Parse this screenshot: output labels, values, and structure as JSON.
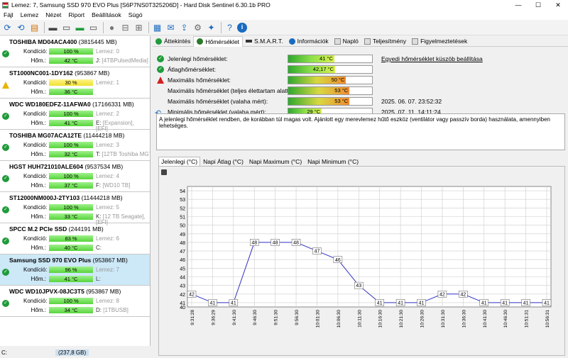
{
  "window": {
    "title": "Lemez: 7, Samsung SSD 970 EVO Plus [S6P7NS0T325206D]  -  Hard Disk Sentinel 6.30.1b PRO",
    "min": "—",
    "max": "☐",
    "close": "✕"
  },
  "menu": [
    "Fájl",
    "Lemez",
    "Nézet",
    "Riport",
    "Beállítások",
    "Súgó"
  ],
  "labels": {
    "kondicio": "Kondíció:",
    "hom": "Hőm.:"
  },
  "disks": [
    {
      "name": "TOSHIBA MD04ACA400",
      "size": "(3815445 MB)",
      "status": "ok",
      "health": "100 %",
      "healthFill": 1.0,
      "temp": "42 °C",
      "lemez": "Lemez: 0",
      "info1": "J:",
      "info1b": "[4TBPulsedMedia]",
      "info2": "",
      "info2b": ""
    },
    {
      "name": "ST1000NC001-1DY162",
      "size": "(953867 MB)",
      "status": "warn",
      "health": "30 %",
      "healthFill": 1.0,
      "temp": "36 °C",
      "lemez": "Lemez: 1",
      "info1": "",
      "info1b": "",
      "info2": "",
      "info2b": ""
    },
    {
      "name": "WDC WD180EDFZ-11AFWA0",
      "size": "(17166331 MB)",
      "status": "ok",
      "health": "100 %",
      "healthFill": 1.0,
      "temp": "41 °C",
      "lemez": "Lemez: 2",
      "info1": "E:",
      "info1b": "[Expansion],",
      "info2": "",
      "info2b": "[EFI]"
    },
    {
      "name": "TOSHIBA MG07ACA12TE",
      "size": "(11444218 MB)",
      "status": "ok",
      "health": "100 %",
      "healthFill": 1.0,
      "temp": "32 °C",
      "lemez": "Lemez: 3",
      "info1": "T:",
      "info1b": "[12TB Toshiba MG7",
      "info2": "",
      "info2b": ""
    },
    {
      "name": "HGST HUH721010ALE604",
      "size": "(9537534 MB)",
      "status": "ok",
      "health": "100 %",
      "healthFill": 1.0,
      "temp": "37 °C",
      "lemez": "Lemez: 4",
      "info1": "F:",
      "info1b": "[WD10 TB]",
      "info2": "",
      "info2b": ""
    },
    {
      "name": "ST12000NM000J-2TY103",
      "size": "(11444218 MB)",
      "status": "ok",
      "health": "100 %",
      "healthFill": 1.0,
      "temp": "33 °C",
      "lemez": "Lemez: 5",
      "info1": "K:",
      "info1b": "[12 TB Seagate],",
      "info2": "",
      "info2b": "[EFI]"
    },
    {
      "name": "SPCC M.2 PCIe SSD",
      "size": "(244191 MB)",
      "status": "ok",
      "health": "83 %",
      "healthFill": 0.83,
      "temp": "40 °C",
      "lemez": "Lemez: 6",
      "info1": "C:",
      "info1b": "",
      "info2": "",
      "info2b": ""
    },
    {
      "name": "Samsung SSD 970 EVO Plus",
      "size": "(953867 MB)",
      "status": "ok",
      "health": "96 %",
      "healthFill": 0.96,
      "temp": "41 °C",
      "lemez": "Lemez: 7",
      "info1": "L:",
      "info1b": "",
      "info2": "",
      "info2b": ""
    },
    {
      "name": "WDC WD10JPVX-08JC3T5",
      "size": "(953867 MB)",
      "status": "ok",
      "health": "100 %",
      "healthFill": 1.0,
      "temp": "34 °C",
      "lemez": "Lemez: 8",
      "info1": "D:",
      "info1b": "[1TBUSB]",
      "info2": "",
      "info2b": ""
    }
  ],
  "leftstatus": {
    "drive": "C:",
    "value": "(237,8 GB)"
  },
  "tabs": [
    "Áttekintés",
    "Hőmérséklet",
    "S.M.A.R.T.",
    "Információk",
    "Napló",
    "Teljesítmény",
    "Figyelmeztetések"
  ],
  "temps": [
    {
      "label": "Jelenlegi hőmérséklet:",
      "value": "41 °C",
      "fill": 0.55,
      "color": "g",
      "icon": "ok",
      "extra": "Egyedi hőmérséklet küszöb beállítása",
      "link": true
    },
    {
      "label": "Átlaghőmérséklet:",
      "value": "42,17 °C",
      "fill": 0.56,
      "color": "g",
      "icon": "ok",
      "extra": "",
      "link": false
    },
    {
      "label": "Maximális hőmérséklet:",
      "value": "50 °C",
      "fill": 0.69,
      "color": "o",
      "icon": "warn",
      "extra": "",
      "link": false
    },
    {
      "label": "Maximális hőmérséklet (teljes élettartam alatt):",
      "value": "53 °C",
      "fill": 0.73,
      "color": "o",
      "icon": "none",
      "extra": "",
      "link": false
    },
    {
      "label": "Maximális hőmérséklet (valaha mért):",
      "value": "53 °C",
      "fill": 0.73,
      "color": "o",
      "icon": "none",
      "extra": "2025. 06. 07. 23:52:32",
      "link": false
    },
    {
      "label": "Minimális hőmérséklet (valaha mért):",
      "value": "29 °C",
      "fill": 0.4,
      "color": "g",
      "icon": "none",
      "extra": "2025. 07. 11. 14:11:24",
      "link": false
    }
  ],
  "message": "A jelenlegi hőmérséklet rendben, de korábban túl magas volt. Ajánlott egy merevlemez hűtő eszköz (ventilátor vagy passzív borda) használata, amennyiben lehetséges.",
  "chartTabs": [
    "Jelenlegi (°C)",
    "Napi Átlag (°C)",
    "Napi Maximum (°C)",
    "Napi Minimum (°C)"
  ],
  "chart_data": {
    "type": "line",
    "x": [
      "9:31:28",
      "9:36:29",
      "9:41:30",
      "9:46:30",
      "9:51:30",
      "9:56:30",
      "10:01:30",
      "10:06:30",
      "10:11:30",
      "10:16:30",
      "10:21:30",
      "10:26:30",
      "10:31:30",
      "10:36:30",
      "10:41:30",
      "10:46:30",
      "10:51:31",
      "10:56:31"
    ],
    "series": [
      {
        "values": [
          42,
          41,
          41,
          48,
          48,
          48,
          47,
          46,
          43,
          41,
          41,
          41,
          42,
          42,
          41,
          41,
          41,
          41
        ]
      }
    ],
    "yticks": [
      41,
      42,
      43,
      44,
      45,
      46,
      47,
      48,
      49,
      50,
      51,
      52,
      53,
      54
    ],
    "ylim": [
      40.5,
      54.5
    ],
    "color": "#3030c0",
    "grid": true
  }
}
